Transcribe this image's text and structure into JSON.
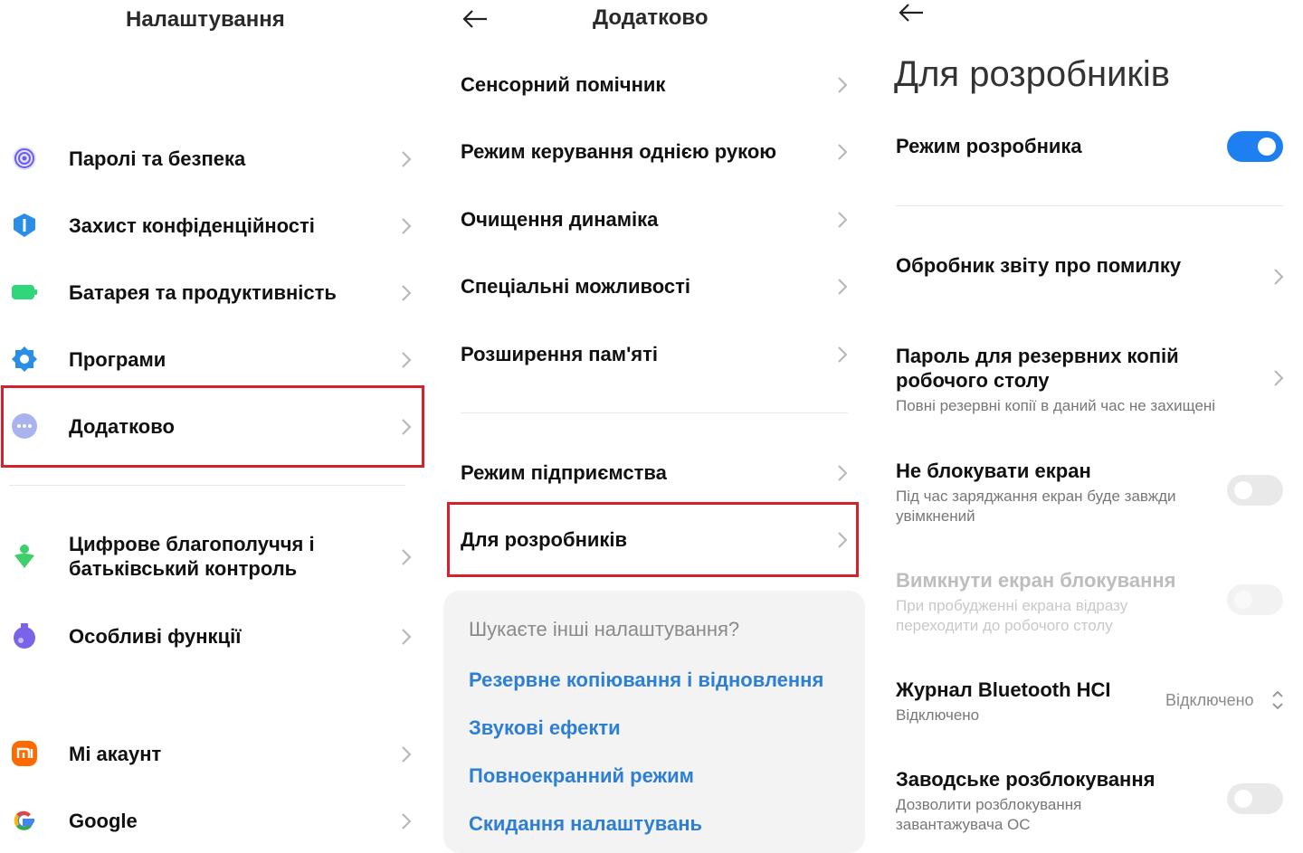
{
  "panel1": {
    "title": "Налаштування",
    "items": [
      {
        "label": "Паролі та безпека",
        "icon": "fingerprint-icon",
        "color": "#6a5cf0"
      },
      {
        "label": "Захист конфіденційності",
        "icon": "privacy-shield-icon",
        "color": "#2a8ee8"
      },
      {
        "label": "Батарея та продуктивність",
        "icon": "battery-icon",
        "color": "#2fd67a"
      },
      {
        "label": "Програми",
        "icon": "gear-icon",
        "color": "#2a8ee8"
      },
      {
        "label": "Додатково",
        "icon": "more-dots-icon",
        "color": "#a9b4ef"
      },
      {
        "label_line1": "Цифрове благополуччя і",
        "label_line2": "батьківський контроль",
        "icon": "wellbeing-icon",
        "color": "#3fcf6a"
      },
      {
        "label": "Особливі функції",
        "icon": "special-features-icon",
        "color": "#7a63e8"
      },
      {
        "label": "Mi акаунт",
        "icon": "mi-logo-icon",
        "color": "#ff6a00"
      },
      {
        "label": "Google",
        "icon": "google-logo-icon",
        "color": "#4285f4"
      }
    ]
  },
  "panel2": {
    "title": "Додатково",
    "items": [
      {
        "label": "Сенсорний помічник"
      },
      {
        "label": "Режим керування однією рукою"
      },
      {
        "label": "Очищення динаміка"
      },
      {
        "label": "Спеціальні можливості"
      },
      {
        "label": "Розширення пам'яті"
      },
      {
        "label": "Режим підприємства"
      },
      {
        "label": "Для розробників"
      }
    ],
    "search": {
      "title": "Шукаєте інші налаштування?",
      "links": [
        "Резервне копіювання і відновлення",
        "Звукові ефекти",
        "Повноекранний режим",
        "Скидання налаштувань"
      ]
    }
  },
  "panel3": {
    "title": "Для розробників",
    "dev_mode": {
      "label": "Режим розробника",
      "on": true
    },
    "bug_report": {
      "label": "Обробник звіту про помилку"
    },
    "backup_password": {
      "line1": "Пароль для резервних копій",
      "line2": "робочого столу",
      "sub": "Повні резервні копії в даний час не захищені"
    },
    "stay_awake": {
      "label": "Не блокувати екран",
      "sub1": "Під час заряджання екран буде завжди",
      "sub2": "увімкнений",
      "on": false
    },
    "disable_lock": {
      "label": "Вимкнути екран блокування",
      "sub1": "При пробудженні екрана відразу",
      "sub2": "переходити до робочого столу",
      "on": false,
      "enabled": false
    },
    "bt_hci": {
      "label": "Журнал Bluetooth HCI",
      "sub": "Відключено",
      "value": "Відключено"
    },
    "oem_unlock": {
      "label": "Заводське розблокування",
      "sub1": "Дозволити розблокування",
      "sub2": "завантажувача ОС",
      "on": false
    }
  },
  "accent": {
    "blue": "#1e7ff0",
    "highlight_red": "#d3212d",
    "link_blue": "#2d7fd3"
  }
}
